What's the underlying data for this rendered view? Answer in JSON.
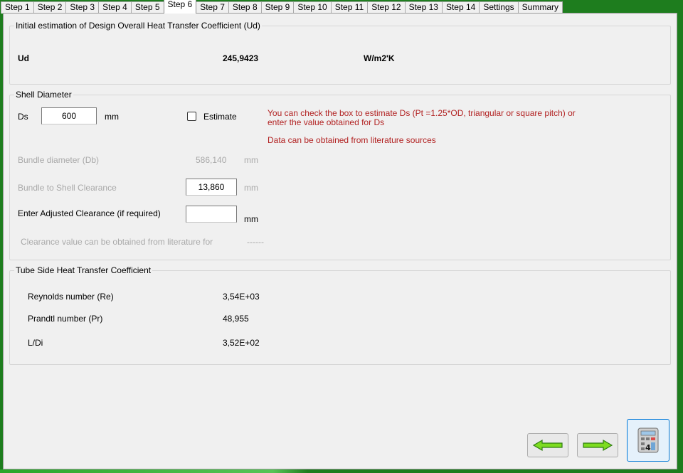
{
  "tabs": [
    {
      "label": "Step 1"
    },
    {
      "label": "Step 2"
    },
    {
      "label": "Step 3"
    },
    {
      "label": "Step 4"
    },
    {
      "label": "Step 5"
    },
    {
      "label": "Step 6"
    },
    {
      "label": "Step 7"
    },
    {
      "label": "Step 8"
    },
    {
      "label": "Step 9"
    },
    {
      "label": "Step 10"
    },
    {
      "label": "Step 11"
    },
    {
      "label": "Step 12"
    },
    {
      "label": "Step 13"
    },
    {
      "label": "Step 14"
    },
    {
      "label": "Settings"
    },
    {
      "label": "Summary"
    }
  ],
  "active_tab": "Step 6",
  "ud_group": {
    "title": "Initial estimation of Design Overall Heat Transfer Coefficient (Ud)",
    "label": "Ud",
    "value": "245,9423",
    "unit": "W/m2'K"
  },
  "shell_group": {
    "title": "Shell Diameter",
    "ds_label": "Ds",
    "ds_value": "600",
    "ds_unit": "mm",
    "estimate_label": "Estimate",
    "estimate_checked": false,
    "hint_line1": "You can check the box to estimate Ds (Pt =1.25*OD, triangular or square pitch) or",
    "hint_line2": "enter the value obtained for Ds",
    "hint_line3": "Data can be obtained from literature sources",
    "bundle_label": "Bundle diameter (Db)",
    "bundle_value": "586,140",
    "bundle_unit": "mm",
    "clearance_label": "Bundle to Shell Clearance",
    "clearance_value": "13,860",
    "clearance_unit": "mm",
    "adjusted_label": "Enter Adjusted Clearance (if required)",
    "adjusted_value": "",
    "adjusted_unit": "mm",
    "literature_label": "Clearance value can be obtained from literature for",
    "literature_value": "------"
  },
  "tube_group": {
    "title": "Tube Side Heat Transfer Coefficient",
    "rows": [
      {
        "label": "Reynolds number (Re)",
        "value": "3,54E+03"
      },
      {
        "label": "Prandtl number (Pr)",
        "value": "48,955"
      },
      {
        "label": "L/Di",
        "value": "3,52E+02"
      }
    ]
  },
  "colors": {
    "window_frame": "#1e7d1e",
    "panel": "#f0f0f0",
    "hint_text": "#b22222",
    "disabled_text": "#a9a9a9",
    "arrow_fill": "#7ddc1f",
    "arrow_stroke": "#2e7d12"
  },
  "icons": {
    "back": "left-arrow-icon",
    "next": "right-arrow-icon",
    "calculate": "calculator-icon"
  }
}
